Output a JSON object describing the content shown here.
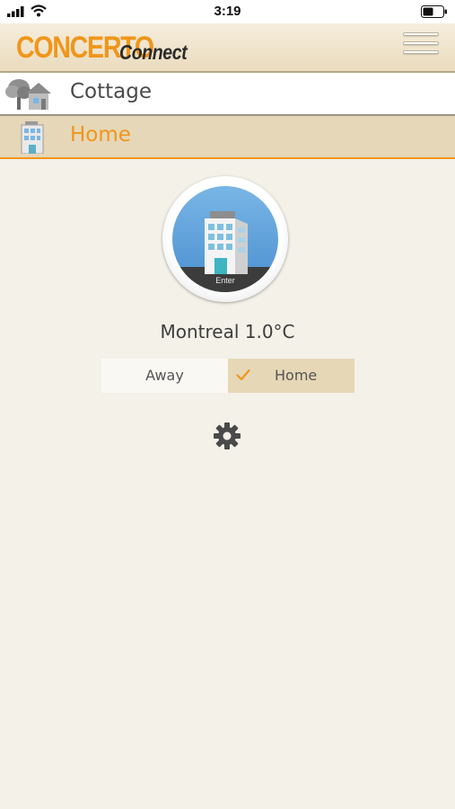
{
  "status_bar": {
    "time": "3:19",
    "icons": [
      "signal-icon",
      "wifi-icon",
      "battery-icon"
    ]
  },
  "header": {
    "logo_main": "CONCERTO",
    "logo_sub": "Connect",
    "menu_icon": "hamburger-menu-icon"
  },
  "locations": [
    {
      "label": "Cottage",
      "icon": "cottage-icon",
      "selected": false
    },
    {
      "label": "Home",
      "icon": "building-icon",
      "selected": true
    }
  ],
  "main": {
    "enter_label": "Enter",
    "location_text": "Montreal 1.0°C",
    "modes": {
      "away_label": "Away",
      "home_label": "Home",
      "active": "Home"
    },
    "settings_icon": "gear-icon"
  },
  "colors": {
    "accent": "#f0961b",
    "background": "#f3f1e8",
    "selected_row": "#e5d7b7",
    "avatar_sky": "#5a9fdc"
  }
}
